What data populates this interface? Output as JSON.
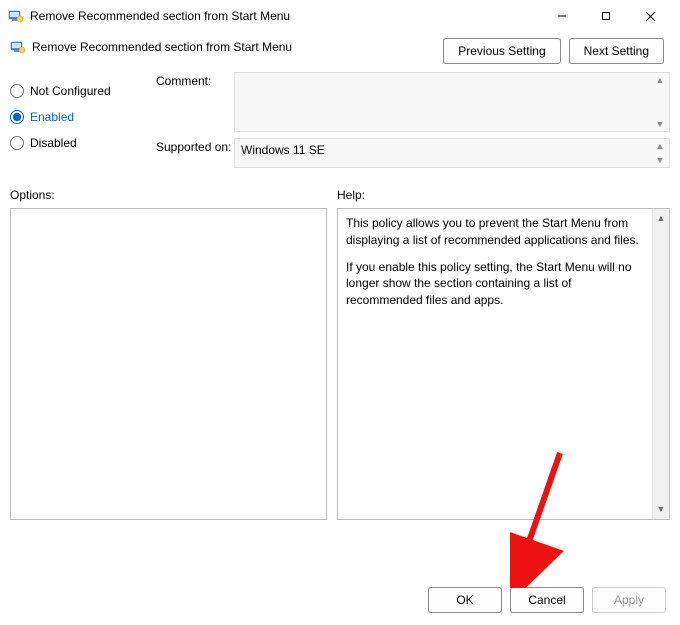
{
  "window": {
    "title": "Remove Recommended section from Start Menu"
  },
  "subheader": {
    "title": "Remove Recommended section from Start Menu"
  },
  "nav": {
    "previous": "Previous Setting",
    "next": "Next Setting"
  },
  "state": {
    "not_configured_label": "Not Configured",
    "enabled_label": "Enabled",
    "disabled_label": "Disabled",
    "selected": "enabled"
  },
  "fields": {
    "comment_label": "Comment:",
    "comment_value": "",
    "supported_label": "Supported on:",
    "supported_value": "Windows 11 SE"
  },
  "sections": {
    "options_label": "Options:",
    "help_label": "Help:"
  },
  "help": {
    "p1": "This policy allows you to prevent the Start Menu from displaying a list of recommended applications and files.",
    "p2": "If you enable this policy setting, the Start Menu will no longer show the section containing a list of recommended files and apps."
  },
  "footer": {
    "ok": "OK",
    "cancel": "Cancel",
    "apply": "Apply"
  }
}
